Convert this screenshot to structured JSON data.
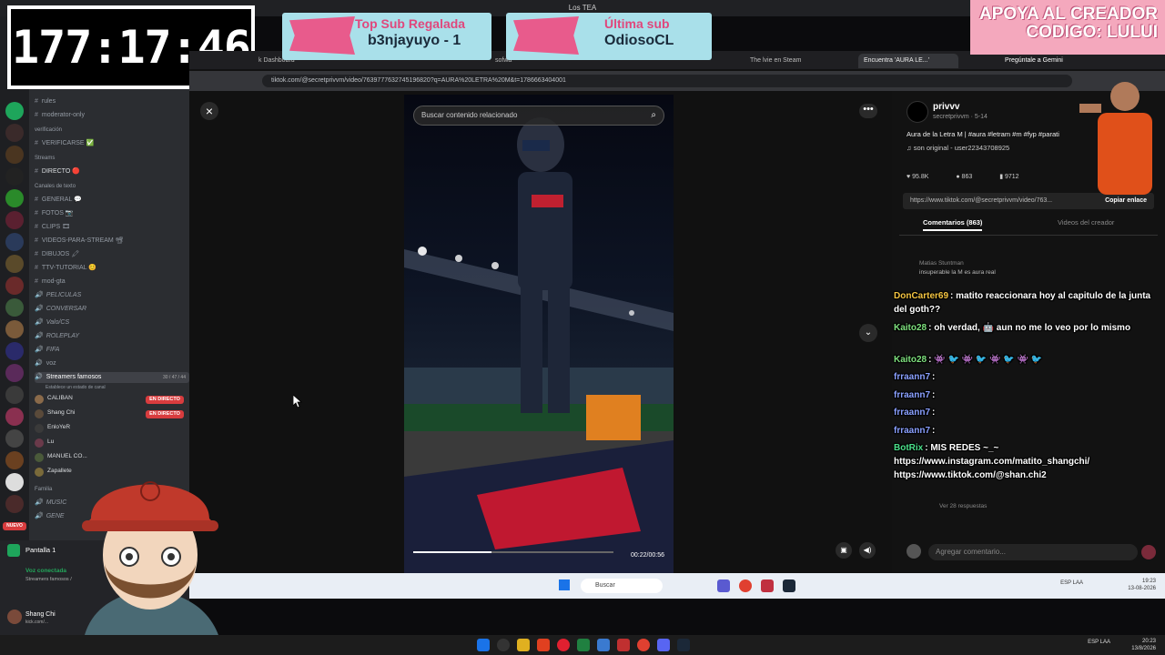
{
  "window": {
    "title": "Los TEA"
  },
  "timer": {
    "value": "177:17:46"
  },
  "alerts": [
    {
      "title": "Top Sub Regalada",
      "value": "b3njayuyo - 1"
    },
    {
      "title": "Última sub",
      "value": "OdiosoCL"
    }
  ],
  "promo": {
    "line1": "APOYA AL CREADOR",
    "line2": "CODIGO: LULUI"
  },
  "discord": {
    "channels": [
      "rules",
      "moderator-only"
    ],
    "cat_verif": "verificación",
    "verif_channel": "VERIFICARSE ✅",
    "cat_streams": "Streams",
    "directo": "DIRECTO 🔴",
    "cat_text": "Canales de texto",
    "text_channels": [
      "GENERAL 💬",
      "FOTOS 📷",
      "CLIPS 🎞",
      "VIDEOS-PARA-STREAM 📽",
      "DIBUJOS 🖍",
      "TTV-TUTORIAL 😊",
      "mod-gta"
    ],
    "voice_channels": [
      "PELICULAS",
      "CONVERSAR",
      "Valo/CS",
      "ROLEPLAY",
      "FIFA",
      "voz"
    ],
    "famosos": "Streamers famosos",
    "famosos_count": "30 / 47 / 44",
    "famosos_status": "Establece un estado de canal",
    "users": [
      "CALIBAN",
      "Shang Chi",
      "EnloYeR",
      "Lu",
      "MANUEL CO...",
      "Zapallete"
    ],
    "live_label": "EN DIRECTO",
    "cat_familia": "Familia",
    "familia": [
      "MUSIC",
      "GENE"
    ],
    "pantalla": "Pantalla 1",
    "voz_conectada": "Voz conectada",
    "voz_sub": "Streamers famosos /",
    "bottom_user": "Shang Chi",
    "bottom_sub": "kick.com/...",
    "nuevo": "NUEVO"
  },
  "browser": {
    "tabs": [
      "k Dashboard",
      "sofwa",
      "The lvie en Steam",
      "Encuentra 'AURA LE...'",
      "Pregúntale a Gemini"
    ],
    "url": "tiktok.com/@secretprivvm/video/7639777632745196820?q=AURA%20LETRA%20M&t=1786663404001"
  },
  "video": {
    "search_placeholder": "Buscar contenido relacionado",
    "time": "00:22/00:56",
    "progress": 0.39
  },
  "post": {
    "name": "privvv",
    "handle": "secretprivvm · 5-14",
    "desc": "Aura de la Letra M | #aura #letram #m #fyp #parati",
    "sound": "♫ son original - user22343708925",
    "likes": "95.8K",
    "comments": "863",
    "saves": "9712",
    "link": "https://www.tiktok.com/@secretprivvm/video/763...",
    "copy": "Copiar enlace",
    "tab_comments": "Comentarios (863)",
    "tab_videos": "Videos del creador",
    "first_commenter": "Matias Stuntman",
    "first_comment": "insuperable la M es aura real",
    "more_replies": "Ver 28 respuestas",
    "add_placeholder": "Agregar comentario..."
  },
  "chat": [
    {
      "user": "DonCarter69",
      "color": "#f5c542",
      "text": ": matito reaccionara hoy al capitulo de la junta del goth??"
    },
    {
      "user": "Kaito28",
      "color": "#7ee07e",
      "text": ": oh verdad, 🤖 aun no me lo veo por lo mismo"
    },
    {
      "user": "Kaito28",
      "color": "#7ee07e",
      "text": ": 👾 🐦 👾 🐦 👾 🐦 👾 🐦"
    },
    {
      "user": "frraann7",
      "color": "#8aa0ff",
      "text": ":"
    },
    {
      "user": "frraann7",
      "color": "#8aa0ff",
      "text": ":"
    },
    {
      "user": "frraann7",
      "color": "#8aa0ff",
      "text": ":"
    },
    {
      "user": "frraann7",
      "color": "#8aa0ff",
      "text": ":"
    },
    {
      "user": "BotRix",
      "color": "#4be08a",
      "text": ": MIS REDES ~_~ https://www.instagram.com/matito_shangchi/ https://www.tiktok.com/@shan.chi2"
    }
  ],
  "taskbar": {
    "search": "Buscar",
    "inner_lang": "ESP LAA",
    "inner_time": "19:23",
    "inner_date": "13-08-2026",
    "lang": "ESP LAA",
    "time": "20:23",
    "date": "13/8/2026"
  },
  "colors": {
    "accent_pink": "#e85b8c",
    "alert_bg": "#a9e0ea",
    "live_red": "#d83c3e"
  }
}
